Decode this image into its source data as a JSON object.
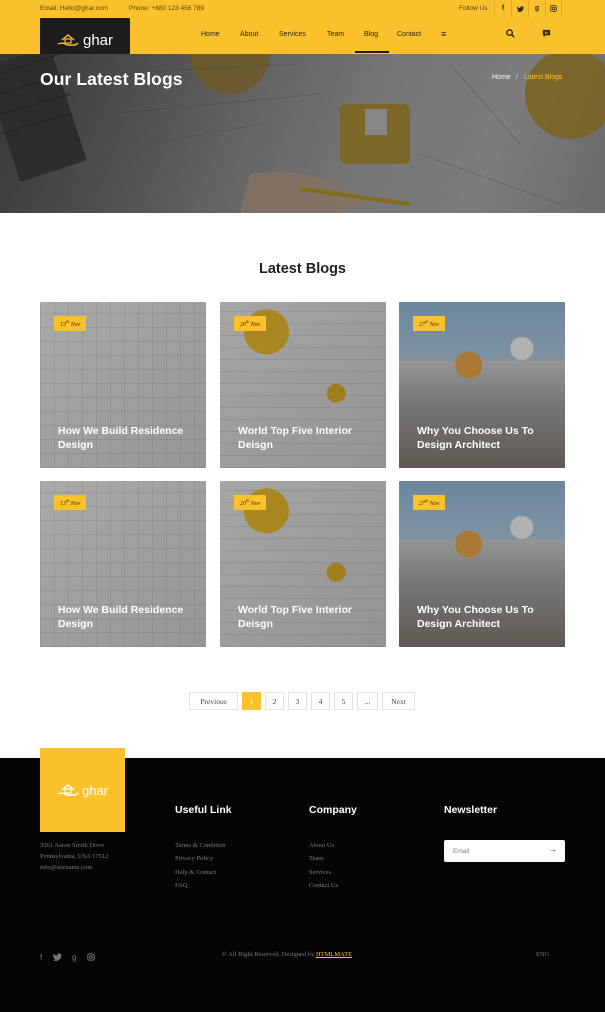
{
  "topbar": {
    "email": "Email: Hello@ghar.com",
    "phone": "Phone: +880 123 456 789",
    "follow": "Follow Us :",
    "social": [
      "f",
      "t",
      "g",
      "i"
    ]
  },
  "brand": {
    "name": "ghar"
  },
  "nav": {
    "items": [
      "Home",
      "About",
      "Services",
      "Team",
      "Blog",
      "Contact"
    ],
    "active": "Blog",
    "menu_icon": "≡"
  },
  "hero": {
    "title": "Our Latest Blogs",
    "breadcrumb_home": "Home",
    "breadcrumb_sep": "/",
    "breadcrumb_current": "Latest Blogs"
  },
  "section": {
    "title": "Latest Blogs"
  },
  "posts": [
    {
      "day": "13",
      "sup": "th",
      "month": "Nov",
      "title": "How We Build Residence Design"
    },
    {
      "day": "20",
      "sup": "th",
      "month": "Nov",
      "title": "World Top Five Interior Deisgn"
    },
    {
      "day": "27",
      "sup": "th",
      "month": "Nov",
      "title": "Why You Choose Us To Design Architect"
    },
    {
      "day": "13",
      "sup": "th",
      "month": "Nov",
      "title": "How We Build Residence Design"
    },
    {
      "day": "20",
      "sup": "th",
      "month": "Nov",
      "title": "World Top Five Interior Deisgn"
    },
    {
      "day": "27",
      "sup": "th",
      "month": "Nov",
      "title": "Why You Choose Us To Design Architect"
    }
  ],
  "pagination": {
    "prev": "Previous",
    "pages": [
      "1",
      "2",
      "3",
      "4",
      "5",
      "..."
    ],
    "active": "1",
    "next": "Next"
  },
  "footer": {
    "address": [
      "3561 Aaron Smith Drive",
      "Pennsylvania, USA 17512",
      "info@sitename.com"
    ],
    "useful_title": "Useful Link",
    "useful_links": [
      "Terms & Condition",
      "Privacy Policy",
      "Help & Contact",
      "FAQ"
    ],
    "company_title": "Company",
    "company_links": [
      "About Us",
      "Team",
      "Services",
      "Contact Us"
    ],
    "newsletter_title": "Newsletter",
    "newsletter_placeholder": "Email",
    "newsletter_submit": "→",
    "copyright": "© All Right Reserved. Designed by",
    "designer": "HTMLMATE",
    "lang": "ENG",
    "social": [
      "f",
      "t",
      "g",
      "i"
    ]
  },
  "colors": {
    "accent": "#f9c12c",
    "dark": "#050505",
    "logo_box": "#1d1d1d"
  }
}
